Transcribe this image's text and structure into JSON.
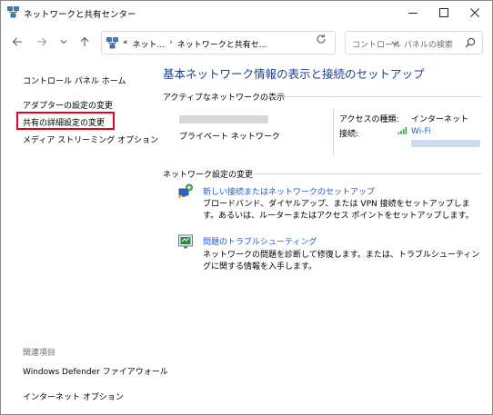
{
  "window": {
    "title": "ネットワークと共有センター"
  },
  "address_bar": {
    "overflow": "«",
    "crumb_1": "ネット...",
    "crumb_2": "ネットワークと共有セ..."
  },
  "search": {
    "placeholder": "コントロール パネルの検索"
  },
  "sidebar": {
    "home": "コントロール パネル ホーム",
    "adapter_settings": "アダプターの設定の変更",
    "advanced_sharing": "共有の詳細設定の変更",
    "media_streaming": "メディア ストリーミング オプション",
    "related_title": "関連項目",
    "firewall": "Windows Defender ファイアウォール",
    "internet_options": "インターネット オプション"
  },
  "main": {
    "title": "基本ネットワーク情報の表示と接続のセットアップ",
    "active_networks_label": "アクティブなネットワークの表示",
    "network_type": "プライベート ネットワーク",
    "access_type_key": "アクセスの種類:",
    "access_type_value": "インターネット",
    "connection_key": "接続:",
    "connection_value": "Wi-Fi",
    "change_settings_label": "ネットワーク設定の変更",
    "tasks": [
      {
        "link": "新しい接続またはネットワークのセットアップ",
        "desc": "ブロードバンド、ダイヤルアップ、または VPN 接続をセットアップします。あるいは、ルーターまたはアクセス ポイントをセットアップします。"
      },
      {
        "link": "問題のトラブルシューティング",
        "desc": "ネットワークの問題を診断して修復します。または、トラブルシューティングに関する情報を入手します。"
      }
    ]
  },
  "colors": {
    "accent": "#1e3f8a",
    "link": "#1e5bd6",
    "highlight": "#e8001c"
  }
}
